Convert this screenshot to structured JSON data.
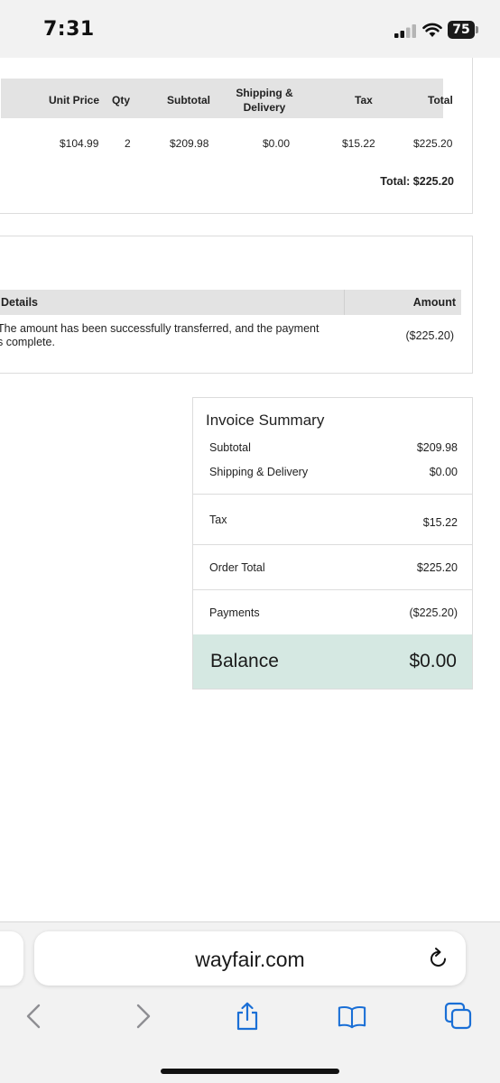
{
  "status_bar": {
    "time": "7:31",
    "battery": "75"
  },
  "order_table": {
    "headers": {
      "unit_price": "Unit Price",
      "qty": "Qty",
      "subtotal": "Subtotal",
      "shipping_line1": "Shipping &",
      "shipping_line2": "Delivery",
      "tax": "Tax",
      "total": "Total"
    },
    "row": {
      "unit_price": "$104.99",
      "qty": "2",
      "subtotal": "$209.98",
      "shipping": "$0.00",
      "tax": "$15.22",
      "total": "$225.20"
    },
    "grand_total": "Total: $225.20"
  },
  "payment_details": {
    "header_details": "Details",
    "header_amount": "Amount",
    "line1": "The amount has been successfully transferred, and the payment",
    "line2": "s complete.",
    "amount": "($225.20)"
  },
  "invoice_summary": {
    "title": "Invoice Summary",
    "subtotal_label": "Subtotal",
    "subtotal_value": "$209.98",
    "shipping_label": "Shipping & Delivery",
    "shipping_value": "$0.00",
    "tax_label": "Tax",
    "tax_value": "$15.22",
    "order_total_label": "Order Total",
    "order_total_value": "$225.20",
    "payments_label": "Payments",
    "payments_value": "($225.20)",
    "balance_label": "Balance",
    "balance_value": "$0.00"
  },
  "browser": {
    "url": "wayfair.com",
    "icons": [
      "back-icon",
      "forward-icon",
      "share-icon",
      "bookmarks-icon",
      "tabs-icon",
      "reload-icon"
    ]
  },
  "colors": {
    "balance_bg": "#d5e8e2",
    "header_bg": "#e3e3e3"
  }
}
